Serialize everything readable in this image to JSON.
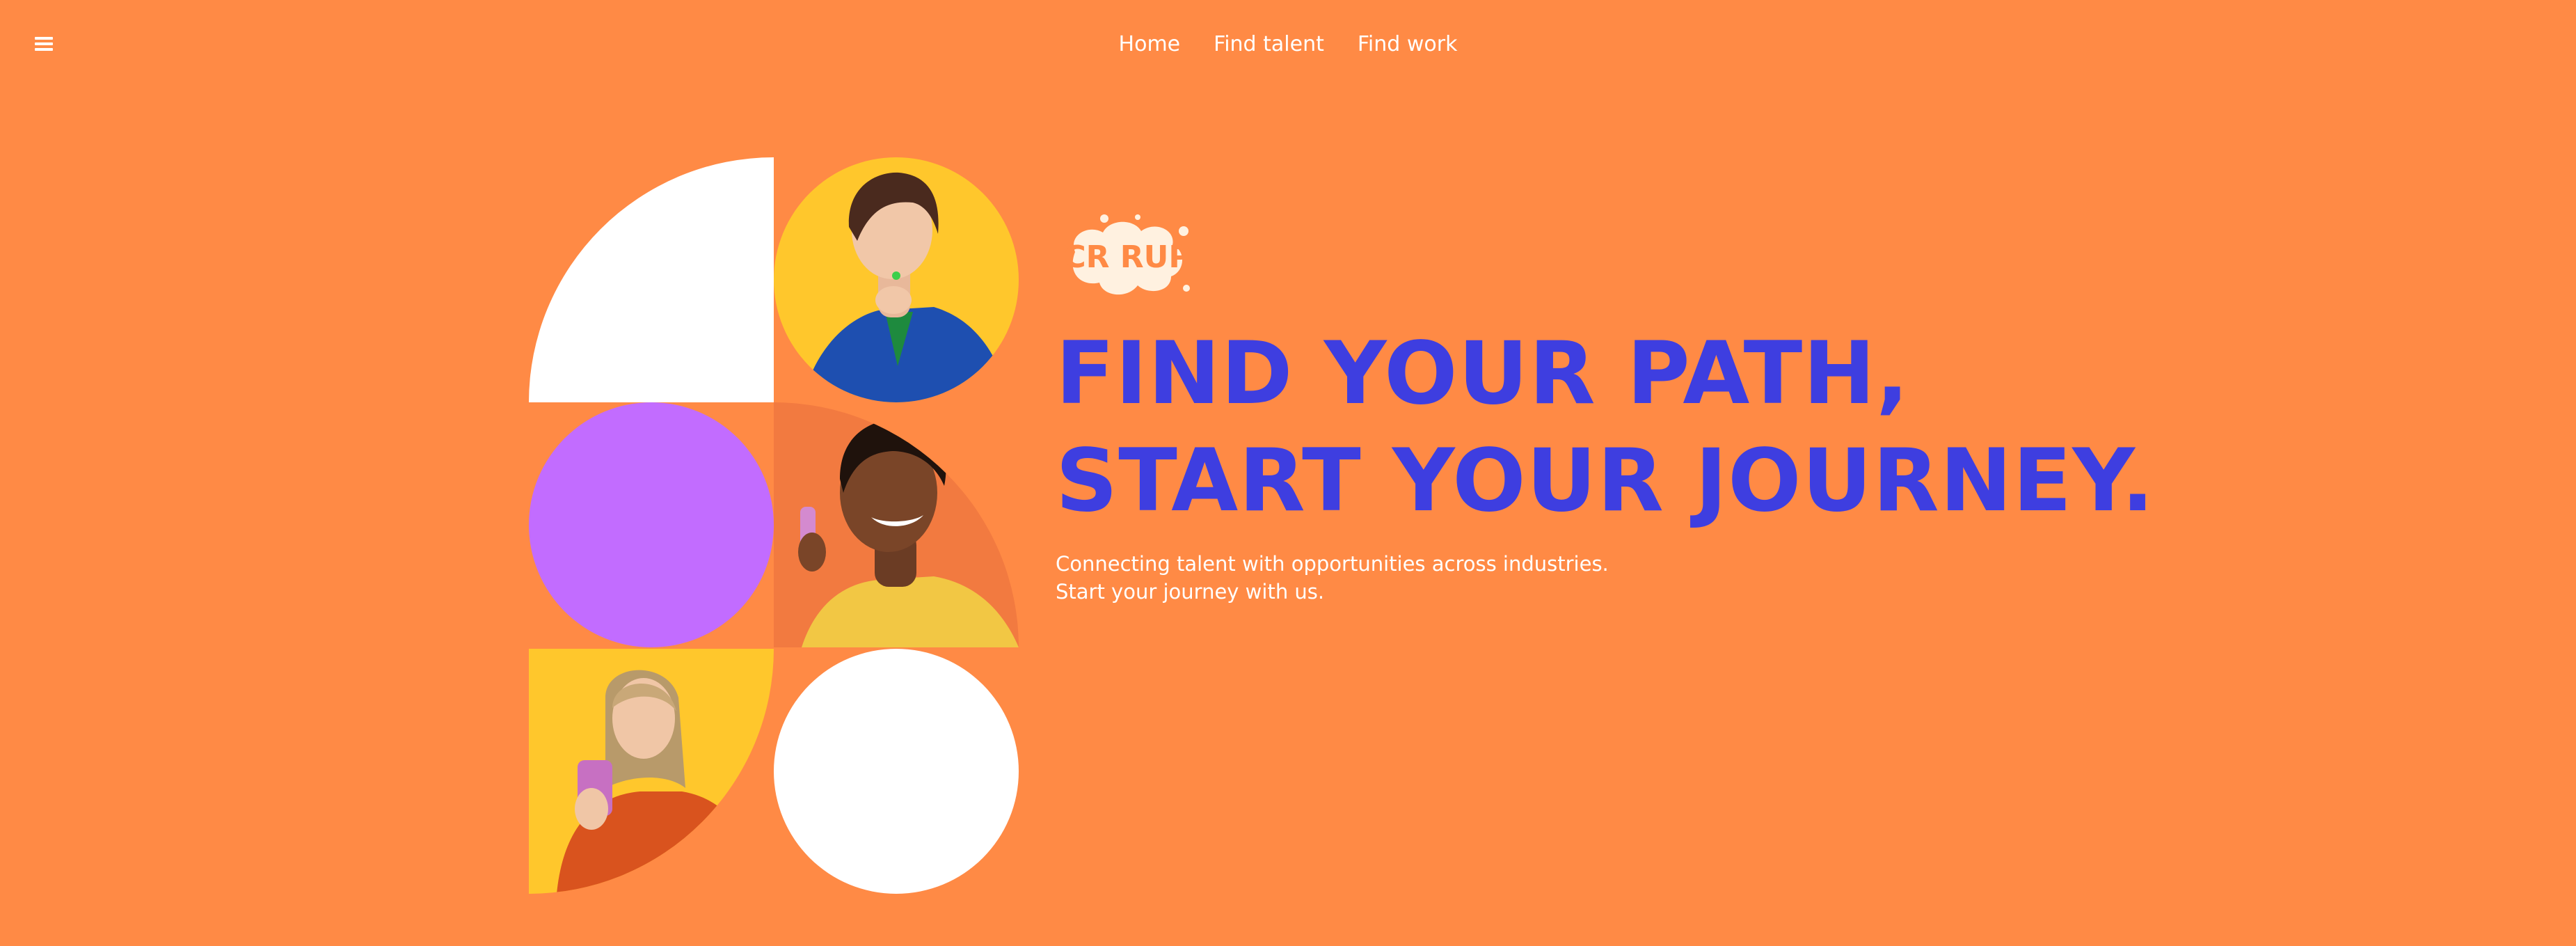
{
  "header": {
    "menu_icon": "hamburger-menu-icon",
    "nav": [
      {
        "label": "Home"
      },
      {
        "label": "Find talent"
      },
      {
        "label": "Find work"
      }
    ]
  },
  "hero": {
    "logo_text": "CR RUP",
    "headline_line1": "FIND YOUR PATH,",
    "headline_line2": "START YOUR JOURNEY.",
    "subtext_line1": "Connecting talent with opportunities across industries.",
    "subtext_line2": "Start your journey with us."
  },
  "colors": {
    "background": "#FF8A45",
    "headline": "#3E3EE0",
    "purple": "#C26CFF",
    "white": "#FFFFFF",
    "yellow": "#FFC72C"
  }
}
